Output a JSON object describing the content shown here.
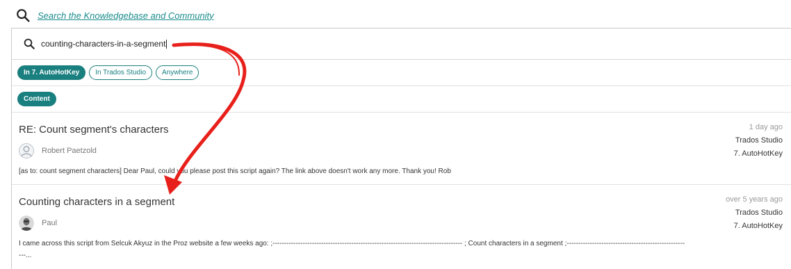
{
  "header": {
    "search_link": "Search the Knowledgebase and Community"
  },
  "search": {
    "query": "counting-characters-in-a-segment"
  },
  "filters": {
    "scope": [
      {
        "label": "In 7. AutoHotKey",
        "active": true
      },
      {
        "label": "In Trados Studio",
        "active": false
      },
      {
        "label": "Anywhere",
        "active": false
      }
    ],
    "types": [
      {
        "label": "Content",
        "active": true
      }
    ]
  },
  "results": [
    {
      "title": "RE: Count segment's characters",
      "author": "Robert Paetzold",
      "time": "1 day ago",
      "category": "Trados Studio",
      "group": "7. AutoHotKey",
      "snippet": "[as to: count segment characters] Dear Paul, could you please post this script again? The link above doesn't work any more. Thank you! Rob"
    },
    {
      "title": "Counting characters in a segment",
      "author": "Paul",
      "time": "over 5 years ago",
      "category": "Trados Studio",
      "group": "7. AutoHotKey",
      "snippet": "I came across this script from Selcuk Akyuz in the Proz website a few weeks ago: ;---------------------------------------------------------------------------------- ; Count characters in a segment ;------------------------------------------------------..."
    }
  ],
  "colors": {
    "accent": "#1a7f7f",
    "link": "#1a8c8c",
    "annotation_arrow": "#e8201b"
  },
  "icons": {
    "search": "search-icon",
    "avatar_placeholder": "user-placeholder-icon",
    "arrow": "curved-arrow-annotation"
  }
}
